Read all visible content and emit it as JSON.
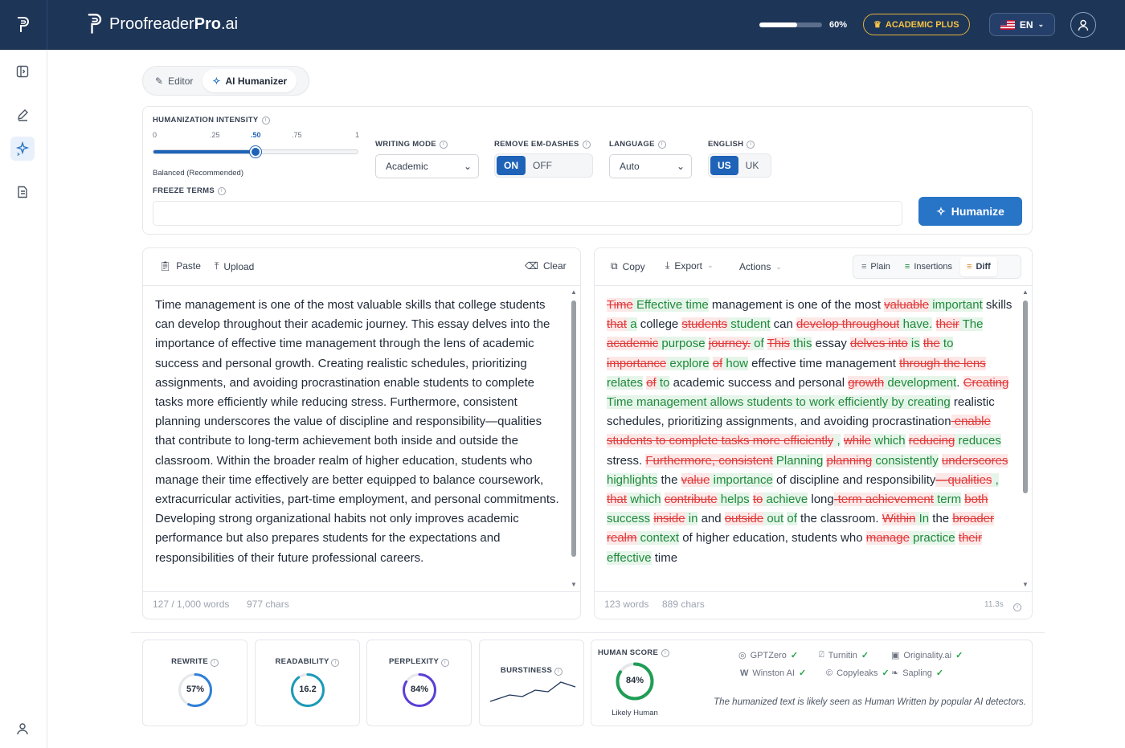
{
  "brand": {
    "name_light": "Proofreader",
    "name_bold": "Pro",
    "name_tail": ".ai"
  },
  "header": {
    "progress_value": 0.6,
    "progress_label": "60%",
    "plan": "ACADEMIC PLUS",
    "language": "EN"
  },
  "tabs": [
    {
      "label": "Editor"
    },
    {
      "label": "AI Humanizer"
    }
  ],
  "settings": {
    "intensity_label": "HUMANIZATION INTENSITY",
    "ticks": [
      "0",
      ".25",
      ".50",
      ".75",
      "1"
    ],
    "intensity_value": 0.5,
    "intensity_caption": "Balanced (Recommended)",
    "writing_mode_label": "WRITING MODE",
    "writing_mode_value": "Academic",
    "em_dash_label": "REMOVE EM-DASHES",
    "em_on": "ON",
    "em_off": "OFF",
    "language_label": "LANGUAGE",
    "language_value": "Auto",
    "english_label": "ENGLISH",
    "eng_us": "US",
    "eng_uk": "UK",
    "freeze_label": "FREEZE TERMS",
    "freeze_value": "",
    "humanize_button": "Humanize"
  },
  "input_panel": {
    "paste": "Paste",
    "upload": "Upload",
    "clear": "Clear",
    "text": "Time management is one of the most valuable skills that college students can develop throughout their academic journey. This essay delves into the importance of effective time management through the lens of academic success and personal growth. Creating realistic schedules, prioritizing assignments, and avoiding procrastination enable students to complete tasks more efficiently while reducing stress. Furthermore, consistent planning underscores the value of discipline and responsibility—qualities that contribute to long-term achievement both inside and outside the classroom. Within the broader realm of higher education, students who manage their time effectively are better equipped to balance coursework, extracurricular activities, part-time employment, and personal commitments. Developing strong organizational habits not only improves academic performance but also prepares students for the expectations and responsibilities of their future professional careers.",
    "words": "127 / 1,000 words",
    "chars": "977 chars"
  },
  "output_panel": {
    "copy": "Copy",
    "export": "Export",
    "actions": "Actions",
    "views": [
      {
        "label": "Plain"
      },
      {
        "label": "Insertions"
      },
      {
        "label": "Diff"
      }
    ],
    "diff": [
      [
        "d",
        "Time"
      ],
      [
        "i",
        " Effective time"
      ],
      [
        "p",
        " management is one of the most "
      ],
      [
        "d",
        "valuable"
      ],
      [
        "i",
        " important"
      ],
      [
        "p",
        " skills "
      ],
      [
        "d",
        "that"
      ],
      [
        "i",
        " a"
      ],
      [
        "p",
        " college "
      ],
      [
        "d",
        "students"
      ],
      [
        "i",
        " student"
      ],
      [
        "p",
        " can "
      ],
      [
        "d",
        "develop throughout"
      ],
      [
        "i",
        " have."
      ],
      [
        "p",
        " "
      ],
      [
        "d",
        "their"
      ],
      [
        "i",
        " The"
      ],
      [
        "p",
        " "
      ],
      [
        "d",
        "academic"
      ],
      [
        "i",
        " purpose"
      ],
      [
        "p",
        " "
      ],
      [
        "d",
        "journey."
      ],
      [
        "i",
        " of"
      ],
      [
        "p",
        " "
      ],
      [
        "d",
        "This"
      ],
      [
        "i",
        " this"
      ],
      [
        "p",
        " essay "
      ],
      [
        "d",
        "delves into"
      ],
      [
        "i",
        " is"
      ],
      [
        "p",
        " "
      ],
      [
        "d",
        "the"
      ],
      [
        "i",
        " to"
      ],
      [
        "p",
        " "
      ],
      [
        "d",
        "importance"
      ],
      [
        "i",
        " explore"
      ],
      [
        "p",
        " "
      ],
      [
        "d",
        "of"
      ],
      [
        "i",
        " how"
      ],
      [
        "p",
        " effective time management "
      ],
      [
        "d",
        "through the lens"
      ],
      [
        "i",
        " relates"
      ],
      [
        "p",
        " "
      ],
      [
        "d",
        "of"
      ],
      [
        "i",
        " to"
      ],
      [
        "p",
        " academic success and personal "
      ],
      [
        "d",
        "growth"
      ],
      [
        "i",
        " development"
      ],
      [
        "p",
        ". "
      ],
      [
        "d",
        "Creating"
      ],
      [
        "i",
        " Time management allows students to work efficiently by creating"
      ],
      [
        "p",
        " realistic schedules, prioritizing assignments, and avoiding procrastination"
      ],
      [
        "d",
        " enable students to complete tasks more efficiently"
      ],
      [
        "i",
        " ,"
      ],
      [
        "p",
        " "
      ],
      [
        "d",
        "while"
      ],
      [
        "i",
        " which"
      ],
      [
        "p",
        " "
      ],
      [
        "d",
        "reducing"
      ],
      [
        "i",
        " reduces"
      ],
      [
        "p",
        " stress. "
      ],
      [
        "d",
        "Furthermore, consistent"
      ],
      [
        "i",
        " Planning"
      ],
      [
        "p",
        " "
      ],
      [
        "d",
        "planning"
      ],
      [
        "i",
        " consistently"
      ],
      [
        "p",
        " "
      ],
      [
        "d",
        "underscores"
      ],
      [
        "i",
        " highlights"
      ],
      [
        "p",
        " the "
      ],
      [
        "d",
        "value"
      ],
      [
        "i",
        " importance"
      ],
      [
        "p",
        " of discipline and responsibility"
      ],
      [
        "d",
        "—qualities"
      ],
      [
        "i",
        " ,"
      ],
      [
        "p",
        " "
      ],
      [
        "d",
        "that"
      ],
      [
        "i",
        " which"
      ],
      [
        "p",
        " "
      ],
      [
        "d",
        "contribute"
      ],
      [
        "i",
        " helps"
      ],
      [
        "p",
        " "
      ],
      [
        "d",
        "to"
      ],
      [
        "i",
        " achieve"
      ],
      [
        "p",
        " long"
      ],
      [
        "d",
        "-term achievement"
      ],
      [
        "i",
        " term"
      ],
      [
        "p",
        " "
      ],
      [
        "d",
        "both"
      ],
      [
        "i",
        " success"
      ],
      [
        "p",
        " "
      ],
      [
        "d",
        "inside"
      ],
      [
        "i",
        " in"
      ],
      [
        "p",
        " and "
      ],
      [
        "d",
        "outside"
      ],
      [
        "i",
        " out"
      ],
      [
        "p",
        " "
      ],
      [
        "i",
        "of"
      ],
      [
        "p",
        " the classroom. "
      ],
      [
        "d",
        "Within"
      ],
      [
        "i",
        " In"
      ],
      [
        "p",
        " the "
      ],
      [
        "d",
        "broader realm"
      ],
      [
        "i",
        " context"
      ],
      [
        "p",
        " of higher education, students who "
      ],
      [
        "d",
        "manage"
      ],
      [
        "i",
        " practice"
      ],
      [
        "p",
        " "
      ],
      [
        "d",
        "their"
      ],
      [
        "i",
        " effective"
      ],
      [
        "p",
        " time"
      ]
    ],
    "words": "123 words",
    "chars": "889 chars",
    "time": "11.3s"
  },
  "metrics": {
    "rewrite": {
      "label": "REWRITE",
      "value": "57%",
      "fraction": 0.57,
      "color": "#2f7fd6"
    },
    "readability": {
      "label": "READABILITY",
      "value": "16.2",
      "fraction": 0.9,
      "color": "#1a9bb8"
    },
    "perplexity": {
      "label": "PERPLEXITY",
      "value": "84%",
      "fraction": 0.84,
      "color": "#5b3fd6"
    },
    "burstiness": {
      "label": "BURSTINESS"
    },
    "human": {
      "label": "HUMAN SCORE",
      "value": "84%",
      "fraction": 0.84,
      "color": "#1f9d55",
      "caption": "Likely Human"
    },
    "detectors": [
      "GPTZero",
      "Turnitin",
      "Originality.ai",
      "Winston AI",
      "Copyleaks",
      "Sapling"
    ],
    "detector_note": "The humanized text is likely seen as Human Written by popular AI detectors."
  }
}
